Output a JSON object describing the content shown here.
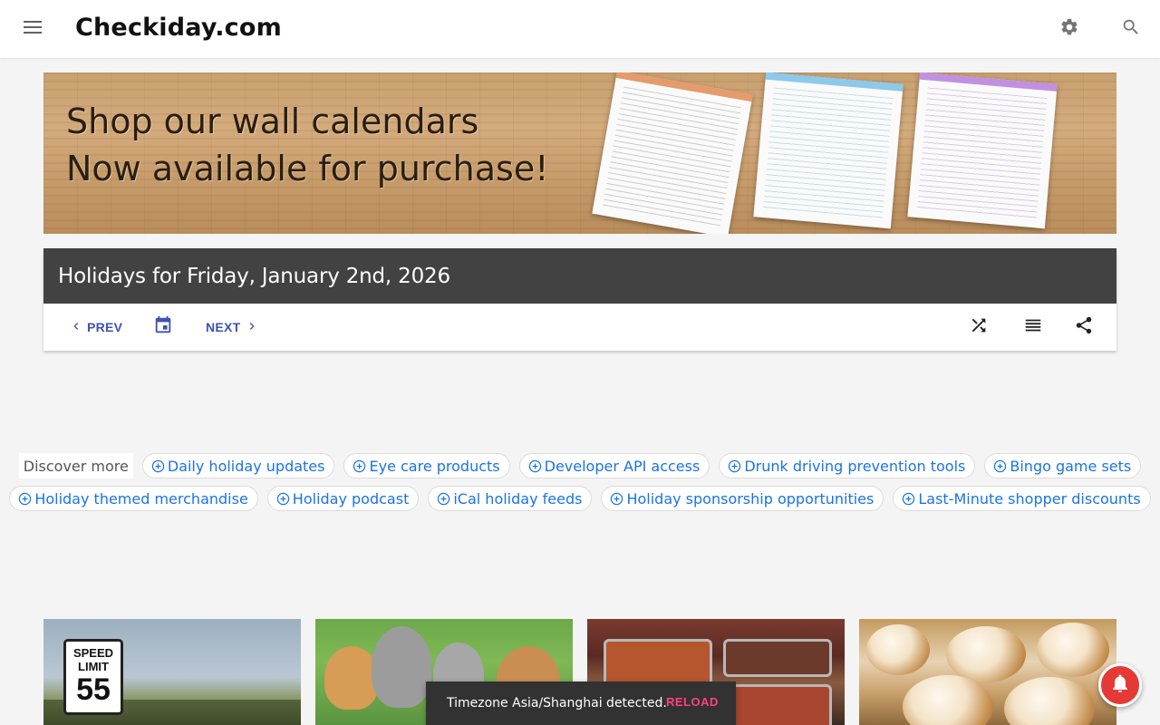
{
  "app": {
    "brand": "Checkiday.com"
  },
  "topbar": {
    "menu_icon": "menu-icon",
    "settings_icon": "gear-icon",
    "search_icon": "search-icon"
  },
  "banner": {
    "line1": "Shop our wall calendars",
    "line2": "Now available for purchase!"
  },
  "datecard": {
    "title": "Holidays for Friday, January 2nd, 2026",
    "prev_label": "PREV",
    "next_label": "NEXT"
  },
  "discover": {
    "label": "Discover more",
    "chips": [
      "Daily holiday updates",
      "Eye care products",
      "Developer API access",
      "Drunk driving prevention tools",
      "Bingo game sets",
      "Holiday themed merchandise",
      "Holiday podcast",
      "iCal holiday feeds",
      "Holiday sponsorship opportunities",
      "Last-Minute shopper discounts"
    ]
  },
  "thumbnails": {
    "sign_top_line1": "SPEED",
    "sign_top_line2": "LIMIT",
    "sign_number": "55"
  },
  "snackbar": {
    "message": "Timezone Asia/Shanghai detected.",
    "action": "RELOAD"
  },
  "colors": {
    "header_dark": "#424242",
    "nav_blue": "#3f51b5",
    "chip_blue": "#1a73e8",
    "snack_accent": "#ff4081",
    "bell_red": "#e53935"
  }
}
